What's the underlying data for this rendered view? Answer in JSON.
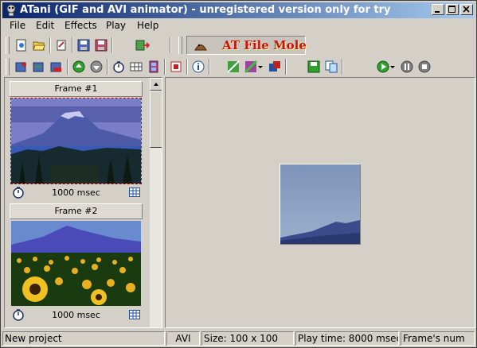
{
  "window": {
    "title": "ATani (GIF and AVI animator) - unregistered version only for try",
    "icon": "app-icon"
  },
  "menu": {
    "items": [
      {
        "label": "File",
        "name": "menu-file"
      },
      {
        "label": "Edit",
        "name": "menu-edit"
      },
      {
        "label": "Effects",
        "name": "menu-effects"
      },
      {
        "label": "Play",
        "name": "menu-play"
      },
      {
        "label": "Help",
        "name": "menu-help"
      }
    ]
  },
  "banner": {
    "text": "AT File Mole"
  },
  "frames": [
    {
      "title": "Frame #1",
      "delay": "1000 msec",
      "selected": true,
      "image": "mountain-lake"
    },
    {
      "title": "Frame #2",
      "delay": "1000 msec",
      "selected": false,
      "image": "sunflowers-mountain"
    }
  ],
  "status": {
    "project": "New project",
    "format": "AVI",
    "size": "Size: 100 x 100",
    "play_time": "Play time: 8000 msec",
    "frames": "Frame's num"
  },
  "colors": {
    "title_start": "#0a246a",
    "title_end": "#a6caf0",
    "face": "#d4d0c8",
    "banner_text": "#d01010"
  }
}
